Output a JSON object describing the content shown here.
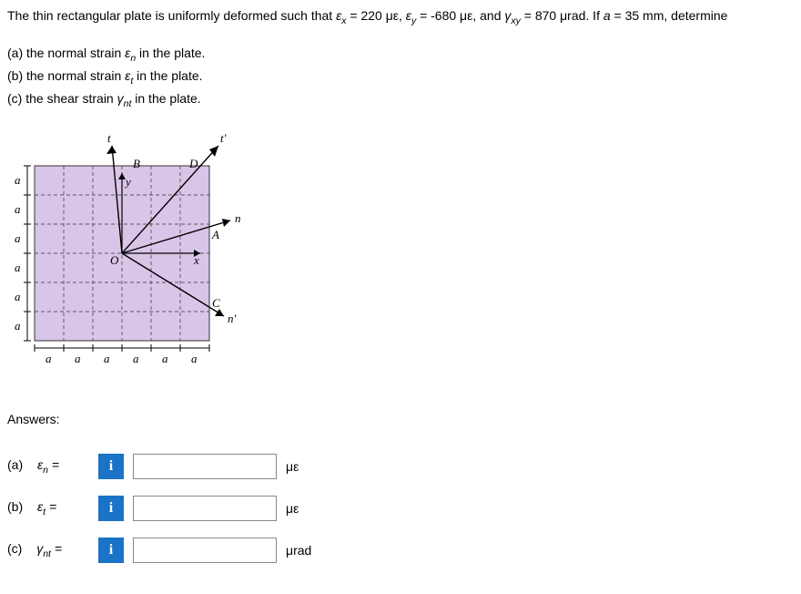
{
  "problem": {
    "pre": "The thin rectangular plate is uniformly deformed such that ",
    "ex_label": "ε",
    "ex_sub": "x",
    "ex_val": " = 220 με, ",
    "ey_label": "ε",
    "ey_sub": "y",
    "ey_val": " = -680 με, and ",
    "gxy_label": "γ",
    "gxy_sub": "xy",
    "gxy_val": " = 870 μrad. If ",
    "a_var": "a",
    "a_val": " = 35 mm, determine"
  },
  "parts": {
    "a_pre": "(a) the normal strain ",
    "a_sym": "ε",
    "a_sub": "n",
    "a_post": " in the plate.",
    "b_pre": "(b) the normal strain ",
    "b_sym": "ε",
    "b_sub": "t",
    "b_post": " in the plate.",
    "c_pre": "(c) the shear strain ",
    "c_sym": "γ",
    "c_sub": "nt",
    "c_post": " in the plate."
  },
  "diagram": {
    "axis_t": "t",
    "axis_tprime": "t'",
    "axis_n": "n",
    "axis_nprime": "n'",
    "axis_x": "x",
    "axis_y": "y",
    "label_B": "B",
    "label_D": "D",
    "label_A": "A",
    "label_C": "C",
    "label_O": "O",
    "label_a": "a"
  },
  "answers": {
    "header": "Answers:",
    "a_prefix": "(a)",
    "a_sym": "ε",
    "a_sub": "n",
    "a_eq": " =",
    "a_unit": "με",
    "b_prefix": "(b)",
    "b_sym": "ε",
    "b_sub": "t",
    "b_eq": " =",
    "b_unit": "με",
    "c_prefix": "(c)",
    "c_sym": "γ",
    "c_sub": "nt",
    "c_eq": " =",
    "c_unit": "μrad",
    "info_icon": "i"
  }
}
